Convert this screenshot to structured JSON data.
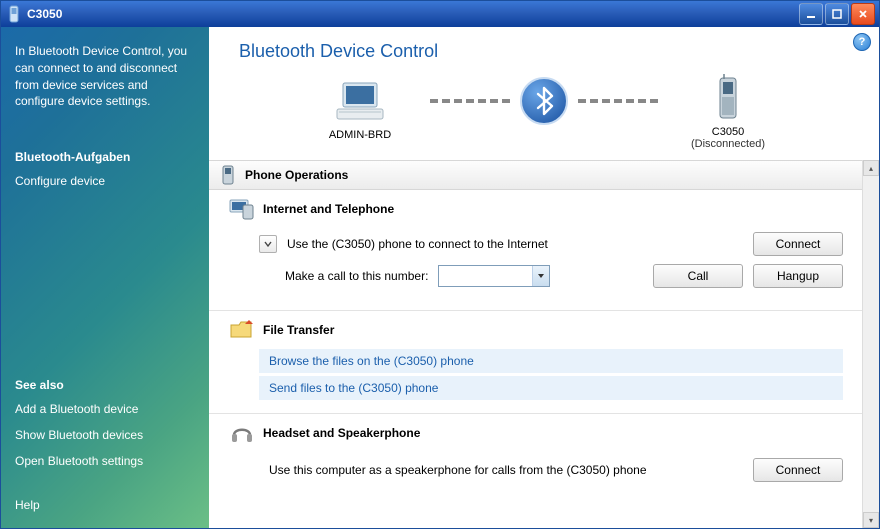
{
  "window": {
    "title": "C3050"
  },
  "sidebar": {
    "description": "In Bluetooth Device Control, you can connect to and disconnect from device services and configure device settings.",
    "tasks_title": "Bluetooth-Aufgaben",
    "configure": "Configure device",
    "seealso_title": "See also",
    "seealso": {
      "add": "Add a Bluetooth device",
      "show": "Show Bluetooth devices",
      "open": "Open Bluetooth settings"
    },
    "help": "Help"
  },
  "main": {
    "title": "Bluetooth Device Control",
    "computer_label": "ADMIN-BRD",
    "device_label": "C3050",
    "device_status": "(Disconnected)",
    "phone_ops_title": "Phone Operations",
    "internet_title": "Internet and Telephone",
    "use_phone_text": "Use the (C3050) phone to connect to the Internet",
    "connect1": "Connect",
    "make_call_label": "Make a call to this number:",
    "call": "Call",
    "hangup": "Hangup",
    "file_transfer_title": "File Transfer",
    "browse_link": "Browse the files on the (C3050) phone",
    "send_link": "Send files to the (C3050) phone",
    "headset_title": "Headset and Speakerphone",
    "speakerphone_text": "Use this computer as a speakerphone for calls from the (C3050) phone",
    "connect2": "Connect"
  }
}
